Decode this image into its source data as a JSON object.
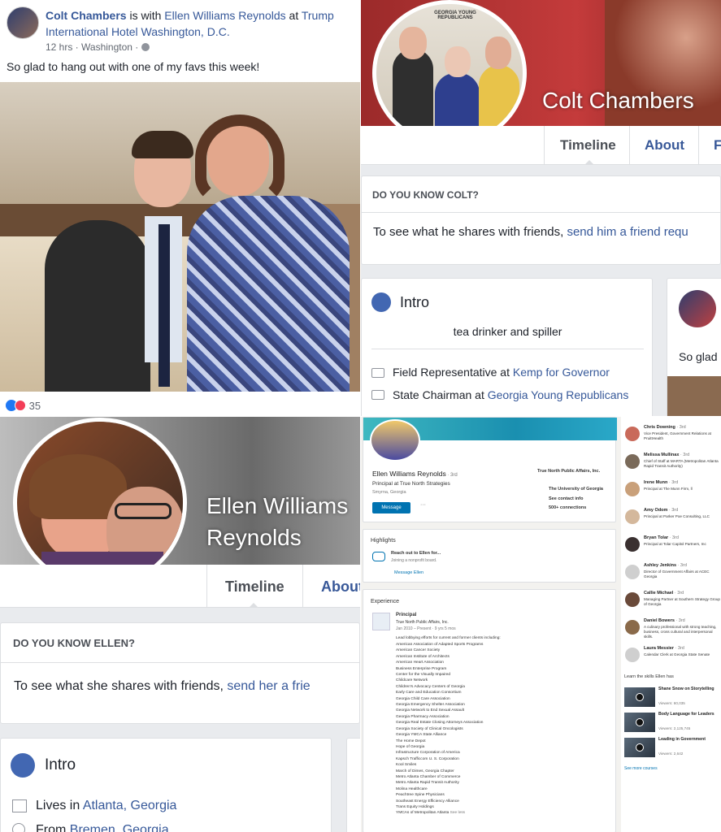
{
  "post": {
    "author": "Colt Chambers",
    "with_text": " is with ",
    "with_name": "Ellen Williams Reynolds",
    "at_text": " at ",
    "place": "Trump International Hotel Washington, D.C.",
    "time": "12 hrs · Washington · ",
    "message": "So glad to hang out with one of my favs this week!",
    "reactions_count": "35"
  },
  "colt_profile": {
    "name": "Colt Chambers",
    "tabs": [
      "Timeline",
      "About",
      "F"
    ],
    "know_heading": "DO YOU KNOW COLT?",
    "know_text": "To see what he shares with friends, ",
    "know_link": "send him a friend requ",
    "intro_title": "Intro",
    "bio": "tea drinker and spiller",
    "job1_text": "Field Representative at ",
    "job1_link": "Kemp for Governor",
    "job2_text": "State Chairman at ",
    "job2_link": "Georgia Young Republicans",
    "side_post": "So glad",
    "banner_text": "GEORGIA YOUNG REPUBLICANS"
  },
  "ellen_profile": {
    "name_line1": "Ellen Williams",
    "name_line2": "Reynolds",
    "tabs": [
      "Timeline",
      "About"
    ],
    "know_heading": "DO YOU KNOW ELLEN?",
    "know_text": "To see what she shares with friends, ",
    "know_link": "send her a frie",
    "intro_title": "Intro",
    "lives_text": "Lives in ",
    "lives_link": "Atlanta, Georgia",
    "from_text": "From ",
    "from_link": "Bremen, Georgia"
  },
  "linkedin": {
    "name": "Ellen Williams Reynolds",
    "degree": " · 3rd",
    "headline": "Principal at True North Strategies",
    "location": "Smyrna, Georgia",
    "message_btn": "Message",
    "more_btn": "···",
    "companies": [
      "True North Public Affairs, Inc.",
      "The University of Georgia"
    ],
    "contact": "See contact info",
    "connections": "500+ connections",
    "highlights_title": "Highlights",
    "highlight_text": "Reach out to Ellen for...",
    "highlight_sub": "Joining a nonprofit board.",
    "highlight_link": "Message Ellen",
    "experience_title": "Experience",
    "job_title": "Principal",
    "job_company": "True North Public Affairs, Inc.",
    "job_dates": "Jan 2010 – Present · 9 yrs 5 mos",
    "clients_intro": "Lead lobbying efforts for current and former clients including:",
    "clients": [
      "American Association of Adapted Sports Programs",
      "American Cancer Society",
      "American Institute of Architects",
      "American Heart Association",
      "Business Enterprise Program",
      "Center for the Visually Impaired",
      "Childcare Network",
      "Children's Advocacy Centers of Georgia",
      "Early Care and Education Consortium",
      "Georgia Child Care Association",
      "Georgia Emergency Shelter Association",
      "Georgia Network to End Sexual Assault",
      "Georgia Pharmacy Association",
      "Georgia Real Estate Closing Attorneys Association",
      "Georgia Society of Clinical Oncologists",
      "Georgia YMCA State Alliance",
      "The Home Depot",
      "Hope of Georgia",
      "Infrastructure Corporation of America",
      "Kapsch Trafficcom U. S. Corporation",
      "Kool Smiles",
      "March of Dimes, Georgia Chapter",
      "Metro Atlanta Chamber of Commerce",
      "Metro Atlanta Rapid Transit Authority",
      "Molina Healthcare",
      "Peachtree Spine Physicians",
      "Southeast Energy Efficiency Alliance",
      "Trans Equity Holdings",
      "YMCAs of Metropolitan Atlanta"
    ],
    "see_less": "See less",
    "people": [
      {
        "name": "Chris Downing",
        "deg": " · 3rd",
        "title": "Vice President, Government Relations at PruittHealth"
      },
      {
        "name": "Melissa Mullinax",
        "deg": " · 3rd",
        "title": "Chief of Staff at MARTA (Metropolitan Atlanta Rapid Transit Authority)"
      },
      {
        "name": "Irene Munn",
        "deg": " · 3rd",
        "title": "Principal at The Munn Firm, ll"
      },
      {
        "name": "Amy Odom",
        "deg": " · 3rd",
        "title": "Principal at Parker Poe Consulting, LLC"
      },
      {
        "name": "Bryan Tolar",
        "deg": " · 3rd",
        "title": "Principal at Tolar Capitol Partners, Inc"
      },
      {
        "name": "Ashley Jenkins",
        "deg": " · 3rd",
        "title": "Director of Government Affairs at ACEC Georgia"
      },
      {
        "name": "Callie Michael",
        "deg": " · 3rd",
        "title": "Managing Partner at Southern Strategy Group of Georgia"
      },
      {
        "name": "Daniel Bowers",
        "deg": " · 3rd",
        "title": "A culinary professional with strong teaching, business, cross cultural and interpersonal skills."
      },
      {
        "name": "Laura Messier",
        "deg": " · 3rd",
        "title": "Calendar Clerk at Georgia State Senate"
      }
    ],
    "skills_title": "Learn the skills Ellen has",
    "courses": [
      {
        "title": "Shane Snow on Storytelling",
        "viewers": "Viewers: 60,035"
      },
      {
        "title": "Body Language for Leaders",
        "viewers": "Viewers: 2,125,745"
      },
      {
        "title": "Leading in Government",
        "viewers": "Viewers: 2,642"
      }
    ],
    "see_more": "See more courses"
  },
  "colors": {
    "fb_blue": "#385898",
    "link_blue": "#365899",
    "li_blue": "#0073b1",
    "red": "#c62828"
  }
}
